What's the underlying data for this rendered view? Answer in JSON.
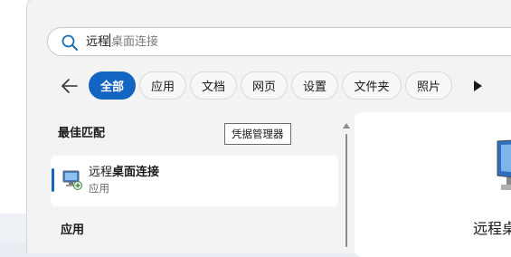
{
  "search": {
    "typed": "远程",
    "suggestion": "桌面连接",
    "icon": "search-icon"
  },
  "nav": {
    "back_icon": "back-arrow-icon",
    "more_icon": "play-right-icon"
  },
  "filters": [
    {
      "label": "全部",
      "active": true
    },
    {
      "label": "应用",
      "active": false
    },
    {
      "label": "文档",
      "active": false
    },
    {
      "label": "网页",
      "active": false
    },
    {
      "label": "设置",
      "active": false
    },
    {
      "label": "文件夹",
      "active": false
    },
    {
      "label": "照片",
      "active": false
    }
  ],
  "best_match": {
    "title": "最佳匹配",
    "tooltip": "凭据管理器",
    "result": {
      "name_prefix": "远程",
      "name_bold": "桌面连接",
      "type": "应用",
      "icon": "remote-desktop-icon"
    }
  },
  "apps_section": {
    "title": "应用"
  },
  "preview": {
    "title": "远程桌",
    "icon": "remote-desktop-icon"
  },
  "colors": {
    "accent": "#1365c2",
    "panel": "#f3f3f3",
    "card": "#ffffff"
  }
}
